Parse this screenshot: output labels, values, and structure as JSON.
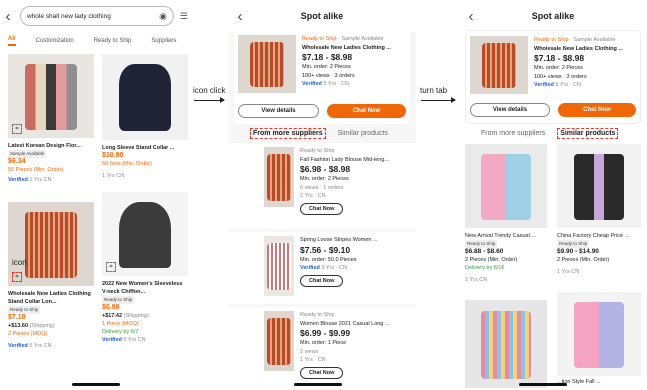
{
  "colors": {
    "accent": "#f0670a",
    "verified": "#1d5fd0",
    "green": "#2a9d3f",
    "highlight": "#e23b2b"
  },
  "annotations": {
    "icon_click": "icon click",
    "turn_tab": "turn tab",
    "icon_label": "icon"
  },
  "search": {
    "value": "whole shall new lady clothing",
    "camera_icon": "camera-icon",
    "filter_icon": "filter-icon"
  },
  "tabs": [
    "All",
    "Customization",
    "Ready to Ship",
    "Suppliers"
  ],
  "results": [
    {
      "title": "Latest Korean Design Flor...",
      "tag": "Sample Available",
      "price": "$6.34",
      "moq": "50 Pieces (Min. Order)",
      "verified": "Verified",
      "years": "1 Yrs CN"
    },
    {
      "title": "Long Sleeve Stand Collar ...",
      "price": "$10.90",
      "moq": "50 Sets (Min. Order)",
      "years": "1 Yrs CN"
    },
    {
      "title": "Wholesale New Ladies Clothing Stand Collar Lon...",
      "tag": "Ready to Ship",
      "price": "$7.18",
      "shipping": "+$13.60",
      "shipping_label": "(Shipping)",
      "moq": "2 Pieces (MOQ)",
      "verified": "Verified",
      "years": "5 Yrs CN"
    },
    {
      "title": "2022 New Women's Sleeveless V-neck Chiffon...",
      "tag": "Ready to Ship",
      "price": "$0.98",
      "shipping": "+$17.42",
      "shipping_label": "(Shipping)",
      "moq": "1 Piece (MOQ)",
      "delivery": "Delivery by 6/7",
      "verified": "Verified",
      "years": "6 Yrs CN"
    }
  ],
  "spot": {
    "title": "Spot alike",
    "product": {
      "badge": "Ready to Ship",
      "badge2": "· Sample Available",
      "name": "Wholesale New Ladies Clothing ...",
      "price": "$7.18 - $8.98",
      "moq": "Min. order: 2 Pieces",
      "views": "100+ views · 3 orders",
      "verified": "Verified",
      "years": "5 Yrs · CN"
    },
    "view_details": "View details",
    "chat_now": "Chat Now",
    "subtabs": [
      "From more suppliers",
      "Similar products"
    ],
    "suppliers": [
      {
        "badge": "Ready to Ship",
        "name": "Fall Fashion Lady Blouse Mid-leng...",
        "price": "$6.98 - $8.98",
        "moq": "Min. order: 2 Pieces",
        "views": "6 views · 1 orders",
        "years": "2 Yrs · CN",
        "chat": "Chat Now"
      },
      {
        "name": "Spring Loose Stripes Women ...",
        "price": "$7.56 - $9.10",
        "moq": "Min. order: 50.0 Pieces",
        "verified": "Verified",
        "years": "3 Yrs · CN",
        "chat": "Chat Now"
      },
      {
        "badge": "Ready to Ship",
        "name": "Women Blouse 2021 Casual Long ...",
        "price": "$6.99 - $9.99",
        "moq": "Min. order: 1 Piece",
        "views": "2 views",
        "years": "1 Yrs · CN",
        "chat": "Chat Now"
      }
    ],
    "similar": [
      {
        "name": "New Arrival Trendy Casual ...",
        "tag": "Ready to Ship",
        "price": "$6.88 - $8.60",
        "moq": "2 Pieces (Min. Order)",
        "delivery": "Delivery by 6/16",
        "years": "2 Yrs CN"
      },
      {
        "name": "China Factory Cheap Price ...",
        "tag": "Ready to Ship",
        "price": "$9.90 - $14.90",
        "moq": "2 Pieces (Min. Order)",
        "years": "1 Yrs CN"
      },
      {
        "name": "...tion Style Fall ..."
      }
    ]
  }
}
